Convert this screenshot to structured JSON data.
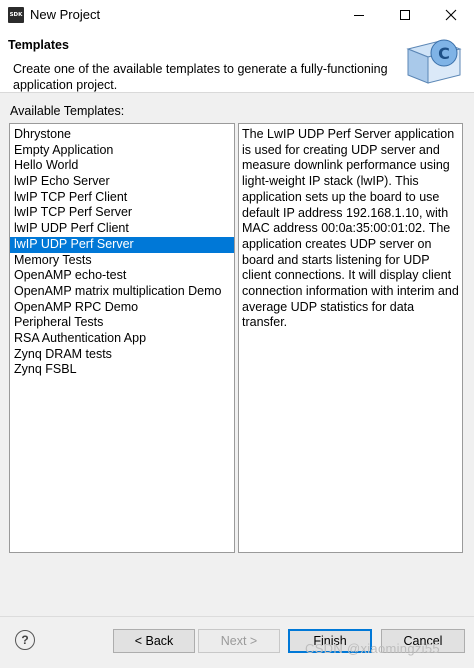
{
  "window": {
    "title": "New Project",
    "app_icon_text": "SDK",
    "controls": [
      "minimize-icon",
      "maximize-icon",
      "close-icon"
    ]
  },
  "header": {
    "title": "Templates",
    "description": "Create one of the available templates to generate a fully-functioning application project.",
    "graphic_letter": "C"
  },
  "templates": {
    "label": "Available Templates:",
    "selected": "lwIP UDP Perf Server",
    "items": [
      "Dhrystone",
      "Empty Application",
      "Hello World",
      "lwIP Echo Server",
      "lwIP TCP Perf Client",
      "lwIP TCP Perf Server",
      "lwIP UDP Perf Client",
      "lwIP UDP Perf Server",
      "Memory Tests",
      "OpenAMP echo-test",
      "OpenAMP matrix multiplication Demo",
      "OpenAMP RPC Demo",
      "Peripheral Tests",
      "RSA Authentication App",
      "Zynq DRAM tests",
      "Zynq FSBL"
    ],
    "description": "The LwIP UDP Perf Server application is used for creating UDP server and measure downlink performance using light-weight IP stack (lwIP). This application sets up the board to use default IP address 192.168.1.10, with MAC address 00:0a:35:00:01:02. The application creates UDP server on board and starts listening for UDP client connections. It will display client connection information with interim and average UDP statistics for data transfer."
  },
  "buttons": {
    "help": "?",
    "back": "< Back",
    "next": "Next >",
    "finish": "Finish",
    "cancel": "Cancel"
  },
  "watermark": "CSDN @xiaomingzi55",
  "colors": {
    "selection": "#0078d7",
    "dialog_bg": "#f0f0f0"
  }
}
